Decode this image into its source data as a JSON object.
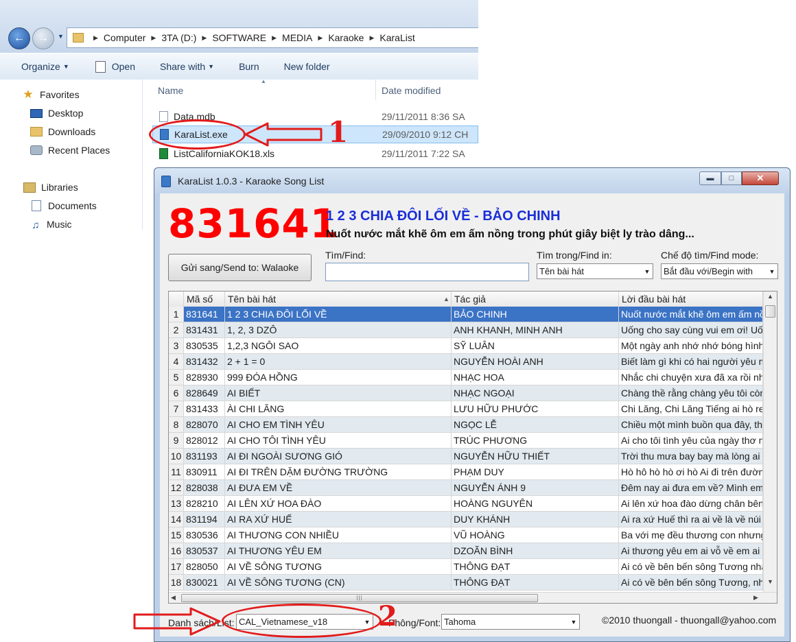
{
  "explorer": {
    "breadcrumb": [
      "Computer",
      "3TA (D:)",
      "SOFTWARE",
      "MEDIA",
      "Karaoke",
      "KaraList"
    ],
    "toolbar": {
      "organize": "Organize",
      "open": "Open",
      "share_with": "Share with",
      "burn": "Burn",
      "new_folder": "New folder"
    },
    "nav_items": [
      {
        "label": "Favorites",
        "icon": "star-icon"
      },
      {
        "label": "Desktop",
        "icon": "desktop-icon"
      },
      {
        "label": "Downloads",
        "icon": "folder-icon"
      },
      {
        "label": "Recent Places",
        "icon": "recent-places-icon"
      },
      {
        "label": "Libraries",
        "icon": "libraries-icon"
      },
      {
        "label": "Documents",
        "icon": "documents-icon"
      },
      {
        "label": "Music",
        "icon": "music-icon"
      }
    ],
    "columns": {
      "name": "Name",
      "date_modified": "Date modified"
    },
    "files": [
      {
        "name": "Data.mdb",
        "date": "29/11/2011 8:36 SA",
        "icon": "file-icon",
        "selected": false
      },
      {
        "name": "KaraList.exe",
        "date": "29/09/2010 9:12 CH",
        "icon": "exe-icon",
        "selected": true
      },
      {
        "name": "ListCaliforniaKOK18.xls",
        "date": "29/11/2011 7:22 SA",
        "icon": "excel-icon",
        "selected": false
      }
    ]
  },
  "annotations": {
    "label_1": "1",
    "label_2": "2",
    "color": "#e21b1b"
  },
  "karalist": {
    "title": "KaraList 1.0.3 - Karaoke Song List",
    "current": {
      "code": "831641",
      "title": "1 2 3 CHIA ĐÔI LỐI VỀ - BẢO CHINH",
      "lyric": "Nuốt nước mắt khẽ ôm em ấm nồng trong phút giây biệt ly trào dâng..."
    },
    "send_button": "Gửi sang/Send to: Walaoke",
    "find_label": "Tìm/Find:",
    "find_value": "",
    "find_in_label": "Tìm trong/Find in:",
    "find_in_value": "Tên bài hát",
    "find_mode_label": "Chế độ tìm/Find mode:",
    "find_mode_value": "Bắt đầu với/Begin with",
    "columns": {
      "code": "Mã số",
      "title": "Tên bài hát",
      "author": "Tác giả",
      "lyric": "Lời đầu bài hát"
    },
    "selected_row": 1,
    "rows": [
      {
        "n": "1",
        "code": "831641",
        "title": "1 2 3 CHIA ĐÔI LỐI VỀ",
        "author": "BẢO CHINH",
        "lyric": "Nuốt nước mắt khẽ ôm em ấm nồng"
      },
      {
        "n": "2",
        "code": "831431",
        "title": "1, 2, 3 DZÔ",
        "author": "ANH KHANH, MINH ANH",
        "lyric": "Uống cho say cùng vui em ơi! Uống"
      },
      {
        "n": "3",
        "code": "830535",
        "title": "1,2,3 NGÔI SAO",
        "author": "SỸ LUÂN",
        "lyric": "Một ngày anh nhớ nhớ bóng hình"
      },
      {
        "n": "4",
        "code": "831432",
        "title": "2 + 1 = 0",
        "author": "NGUYỄN HOÀI ANH",
        "lyric": "Biết làm gì khi có hai người yêu mình"
      },
      {
        "n": "5",
        "code": "828930",
        "title": "999 ĐÓA HỒNG",
        "author": "NHẠC HOA",
        "lyric": "Nhắc chi chuyện xưa đã xa rồi nh"
      },
      {
        "n": "6",
        "code": "828649",
        "title": "AI BIẾT",
        "author": "NHẠC NGOẠI",
        "lyric": "Chàng thề rằng chàng yêu tôi còn"
      },
      {
        "n": "7",
        "code": "831433",
        "title": "ÀI CHI LĂNG",
        "author": "LƯU HỮU PHƯỚC",
        "lyric": "Chi Lăng, Chi Lăng Tiếng ai hò reo"
      },
      {
        "n": "8",
        "code": "828070",
        "title": "AI CHO EM TÌNH YÊU",
        "author": "NGỌC LỄ",
        "lyric": "Chiều một mình buồn qua đây, th"
      },
      {
        "n": "9",
        "code": "828012",
        "title": "AI CHO TÔI TÌNH YÊU",
        "author": "TRÚC PHƯƠNG",
        "lyric": "Ai cho tôi tình yêu của ngày thơ ng"
      },
      {
        "n": "10",
        "code": "831193",
        "title": "AI ĐI NGOÀI SƯƠNG GIÓ",
        "author": "NGUYỄN HỮU THIẾT",
        "lyric": "Trời thu mưa bay bay mà lòng ai"
      },
      {
        "n": "11",
        "code": "830911",
        "title": "AI ĐI TRÊN DẶM ĐƯỜNG TRƯỜNG",
        "author": "PHẠM DUY",
        "lyric": "Hò hô hò hò ơi hò Ai đi trên đường"
      },
      {
        "n": "12",
        "code": "828038",
        "title": "AI ĐƯA EM VỀ",
        "author": "NGUYỄN ÁNH 9",
        "lyric": "Đêm nay ai đưa em về? Mình em"
      },
      {
        "n": "13",
        "code": "828210",
        "title": "AI LÊN XỨ HOA ĐÀO",
        "author": "HOÀNG NGUYÊN",
        "lyric": "Ai lên xứ hoa đào dừng chân bên"
      },
      {
        "n": "14",
        "code": "831194",
        "title": "AI RA XỨ HUẾ",
        "author": "DUY KHÁNH",
        "lyric": "Ai ra xứ Huế thì ra ai về là về núi N"
      },
      {
        "n": "15",
        "code": "830536",
        "title": "AI THƯƠNG CON NHIỀU",
        "author": "VŨ HOÀNG",
        "lyric": "Ba với mẹ đều thương con nhưng"
      },
      {
        "n": "16",
        "code": "830537",
        "title": "AI THƯƠNG YÊU EM",
        "author": "DZOÃN BÌNH",
        "lyric": "Ai thương yêu em ai vỗ về em ai t"
      },
      {
        "n": "17",
        "code": "828050",
        "title": "AI VỀ SÔNG TƯƠNG",
        "author": "THÔNG ĐẠT",
        "lyric": "Ai có về bên bến sông Tương nhắ"
      },
      {
        "n": "18",
        "code": "830021",
        "title": "AI VỀ SÔNG TƯƠNG (CN)",
        "author": "THÔNG ĐẠT",
        "lyric": "Ai có về bên bến sông Tương, nh"
      }
    ],
    "list_label": "Danh sách/List:",
    "list_value": "CAL_Vietnamese_v18",
    "font_label": "Phông/Font:",
    "font_value": "Tahoma",
    "copyright": "©2010 thuongall - thuongall@yahoo.com"
  }
}
